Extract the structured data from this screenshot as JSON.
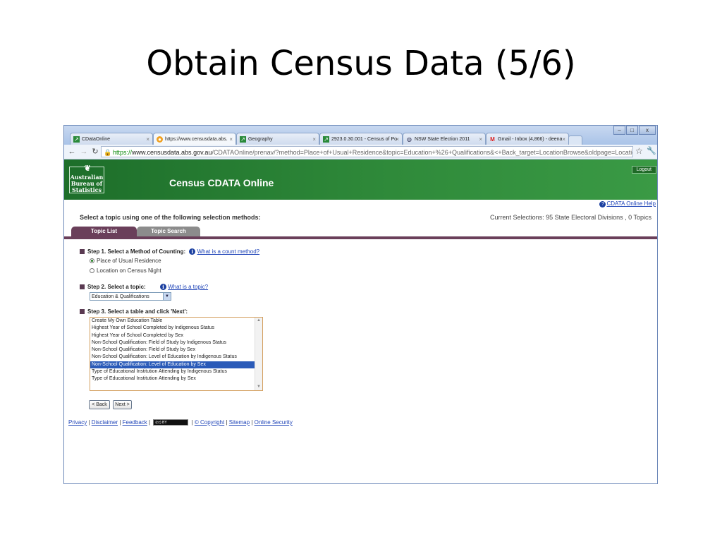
{
  "slide": {
    "title": "Obtain Census Data (5/6)"
  },
  "browser": {
    "tabs": [
      {
        "label": "CDataOnline",
        "favicon": "chart-icon"
      },
      {
        "label": "https://www.censusdata.abs.",
        "favicon": "loading-icon"
      },
      {
        "label": "Geography",
        "favicon": "chart-icon"
      },
      {
        "label": "2923.0.30.001 - Census of Po",
        "favicon": "chart-icon"
      },
      {
        "label": "NSW State Election 2011",
        "favicon": "globe-icon"
      },
      {
        "label": "Gmail - Inbox (4,866) - deena",
        "favicon": "gmail-icon"
      }
    ],
    "url": {
      "scheme": "https://",
      "host": "www.censusdata.abs.gov.au",
      "path": "/CDATAOnline/prenav/?method=Place+of+Usual+Residence&topic=Education+%26+Qualifications&<+Back_target=LocationBrowse&oldpage=LocationBrowse"
    }
  },
  "banner": {
    "logo_lines": [
      "Australian",
      "Bureau of",
      "Statistics"
    ],
    "title": "Census CDATA Online",
    "logout": "Logout"
  },
  "help_link": "CDATA Online Help",
  "select_prompt": "Select a topic using one of the following selection methods:",
  "current_selections": "Current Selections: 95 State Electoral Divisions , 0 Topics",
  "topic_tabs": {
    "list": "Topic List",
    "search": "Topic Search"
  },
  "step1": {
    "label": "Step 1. Select a Method of Counting:",
    "link": "What is a count method?",
    "options": [
      "Place of Usual Residence",
      "Location on Census Night"
    ],
    "selected": 0
  },
  "step2": {
    "label": "Step 2. Select a topic:",
    "link": "What is a topic?",
    "value": "Education & Qualifications"
  },
  "step3": {
    "label": "Step 3. Select a table and click 'Next':",
    "items": [
      "Create My Own Education Table",
      "Highest Year of School Completed by Indigenous Status",
      "Highest Year of School Completed by Sex",
      "Non-School Qualification: Field of Study by Indigenous Status",
      "Non-School Qualification: Field of Study by Sex",
      "Non-School Qualification: Level of Education by Indigenous Status",
      "Non-School Qualification: Level of Education by Sex",
      "Type of Educational Institution Attending by Indigenous Status",
      "Type of Educational Institution Attending by Sex"
    ],
    "selected": 6
  },
  "buttons": {
    "back": "< Back",
    "next": "Next >"
  },
  "footer": {
    "privacy": "Privacy",
    "disclaimer": "Disclaimer",
    "feedback": "Feedback",
    "cc_badge": "(cc) BY",
    "copyright": "© Copyright",
    "sitemap": "Sitemap",
    "security": "Online Security"
  }
}
